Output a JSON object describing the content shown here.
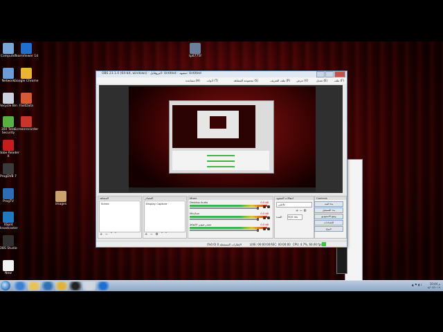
{
  "desktop_icons": [
    {
      "label": "Computer",
      "icon": "computer-icon",
      "color": "#7aa7d9"
    },
    {
      "label": "TeamViewer 14",
      "icon": "teamviewer-icon",
      "color": "#1f6fd1"
    },
    {
      "label": "Network",
      "icon": "network-icon",
      "color": "#6e9cd8"
    },
    {
      "label": "Google Chrome",
      "icon": "chrome-icon",
      "color": "#e9b531"
    },
    {
      "label": "Recycle Bin",
      "icon": "recycle-bin-icon",
      "color": "#c9d2dd"
    },
    {
      "label": "FastData",
      "icon": "fastdata-icon",
      "color": "#d65a33"
    },
    {
      "label": "360 Total Security",
      "icon": "shield-icon",
      "color": "#56b13f"
    },
    {
      "label": "Screenrecorder",
      "icon": "screenrecorder-icon",
      "color": "#c9342b"
    },
    {
      "label": "Adobe Reader X",
      "icon": "adobe-reader-icon",
      "color": "#c71c1c"
    },
    {
      "label": "ProgDVB 7",
      "icon": "progdvb-icon",
      "color": "#3a3a3a"
    },
    {
      "label": "ProgTV",
      "icon": "progtv-icon",
      "color": "#2c6db5"
    },
    {
      "label": "XSplit Broadcaster",
      "icon": "xsplit-icon",
      "color": "#1e7bbf"
    },
    {
      "label": "OBS Studio",
      "icon": "obs-icon",
      "color": "#303030"
    },
    {
      "label": "New",
      "icon": "document-icon",
      "color": "#f2f2f2"
    },
    {
      "label": "images",
      "icon": "image-icon",
      "color": "#c9a36b"
    },
    {
      "label": "tp6775f",
      "icon": "setup-icon",
      "color": "#6a7f9a"
    }
  ],
  "obs": {
    "title": "OBS 23.1.0 (64-bit, windows) - البروفايل: Untitled - مشهد: Untitled",
    "menu": [
      "ملف (F)",
      "تعديل (E)",
      "عرض (V)",
      "ملف التعريف (P)",
      "مجموعة المشاهد (S)",
      "أدوات (T)",
      "مساعدة (H)"
    ],
    "panels": {
      "scenes_title": "المشاهد",
      "scenes": [
        "Scene"
      ],
      "sources_title": "المصادر",
      "sources": [
        "Display Capture"
      ],
      "mixer_title": "Mixer",
      "mixer": [
        {
          "name": "Desktop Audio",
          "db": "0.0 dB"
        },
        {
          "name": "Mic/Aux",
          "db": "0.0 dB"
        },
        {
          "name": "مصدر صوتي الالتقاط",
          "db": "0.0 dB"
        }
      ],
      "transitions_title": "انتقالات المشهد",
      "transition": "تلاشي",
      "duration_label": "المدة",
      "duration": "300 ms",
      "controls_title": "Controls",
      "controls": [
        "بدء البث",
        "بدء التسجيل",
        "وضع الاستوديو",
        "الإعدادات",
        "خروج"
      ]
    },
    "status": {
      "dropped": "الإطارات المسقطة 0 (0.0%)",
      "live": "LIVE: 00:00:00",
      "rec": "REC: 00:00:00",
      "cpu": "CPU: 4.7%, 60.00 fps"
    }
  },
  "taskbar": {
    "time": "10:44 م",
    "date": "٠٥/٠٢/٢٠١٩",
    "apps": [
      "ie-icon",
      "explorer-icon",
      "media-player-icon",
      "chrome-icon",
      "obs-icon",
      "fastdata-icon",
      "teamviewer-icon"
    ]
  },
  "colors": {
    "taskbar": "#9fb4cf",
    "desktop": "#5c0707",
    "obs_status_ok": "#2fd12f"
  }
}
